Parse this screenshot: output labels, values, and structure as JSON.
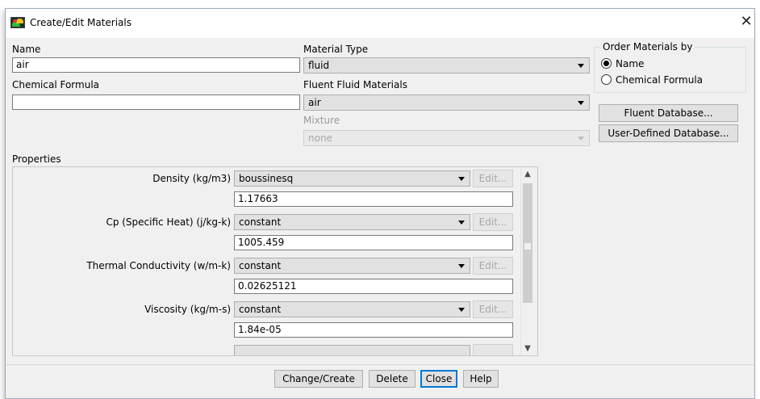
{
  "window": {
    "title": "Create/Edit Materials",
    "close_glyph": "✕"
  },
  "name": {
    "label": "Name",
    "value": "air"
  },
  "chemical_formula": {
    "label": "Chemical Formula",
    "value": ""
  },
  "material_type": {
    "label": "Material Type",
    "value": "fluid"
  },
  "fluent_fluid_materials": {
    "label": "Fluent Fluid Materials",
    "value": "air"
  },
  "mixture": {
    "label": "Mixture",
    "value": "none"
  },
  "order_by": {
    "title": "Order Materials by",
    "options": [
      "Name",
      "Chemical Formula"
    ],
    "selected": "Name"
  },
  "database_buttons": {
    "fluent": "Fluent Database...",
    "user_defined": "User-Defined Database..."
  },
  "properties": {
    "label": "Properties",
    "edit_label": "Edit...",
    "rows": [
      {
        "label": "Density (kg/m3)",
        "method": "boussinesq",
        "value": "1.17663"
      },
      {
        "label": "Cp (Specific Heat) (j/kg-k)",
        "method": "constant",
        "value": "1005.459"
      },
      {
        "label": "Thermal Conductivity (w/m-k)",
        "method": "constant",
        "value": "0.02625121"
      },
      {
        "label": "Viscosity (kg/m-s)",
        "method": "constant",
        "value": "1.84e-05"
      }
    ]
  },
  "footer": {
    "change_create": "Change/Create",
    "delete": "Delete",
    "close": "Close",
    "help": "Help"
  },
  "icons": {
    "app": "fluent-app-icon",
    "close": "close-icon",
    "dropdown": "chevron-down-icon",
    "scroll_up": "scroll-up-icon",
    "scroll_down": "scroll-down-icon"
  },
  "colors": {
    "window_bg": "#f0f0f0",
    "focus_border": "#0078d7",
    "field_border": "#7a7a7a",
    "combo_bg": "#e1e1e1"
  }
}
